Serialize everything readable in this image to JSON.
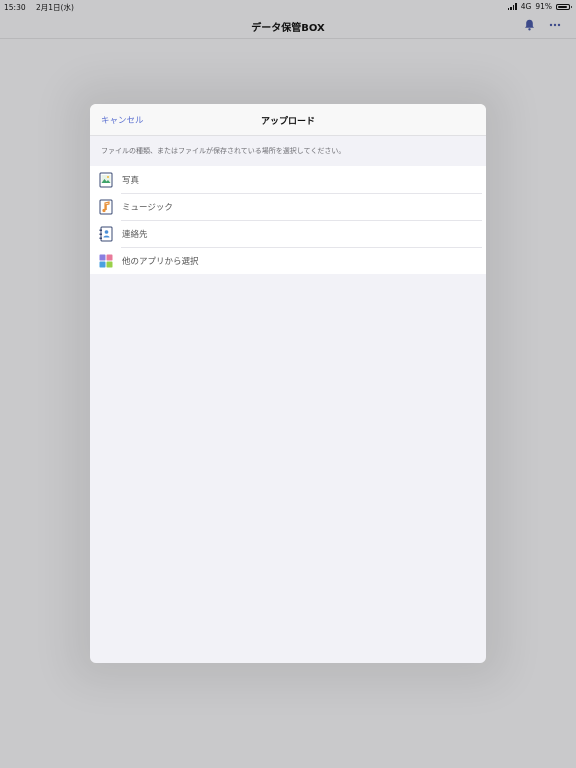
{
  "status_bar": {
    "time": "15:30",
    "date": "2月1日(水)",
    "network": "4G",
    "battery_text": "91%",
    "battery_level": 0.91,
    "battery_icon": "battery-icon",
    "signal_icon": "signal-icon"
  },
  "nav": {
    "title": "データ保管BOX",
    "notification_icon": "bell-icon",
    "more_icon": "more-icon"
  },
  "modal": {
    "cancel_label": "キャンセル",
    "title": "アップロード",
    "description": "ファイルの種類、またはファイルが保存されている場所を選択してください。",
    "options": [
      {
        "label": "写真",
        "icon": "photo-icon"
      },
      {
        "label": "ミュージック",
        "icon": "music-icon"
      },
      {
        "label": "連絡先",
        "icon": "contacts-icon"
      },
      {
        "label": "他のアプリから選択",
        "icon": "apps-icon"
      }
    ]
  },
  "colors": {
    "accent": "#5a6fd0",
    "background": "#c9c9cb",
    "sheet": "#f2f2f7"
  }
}
